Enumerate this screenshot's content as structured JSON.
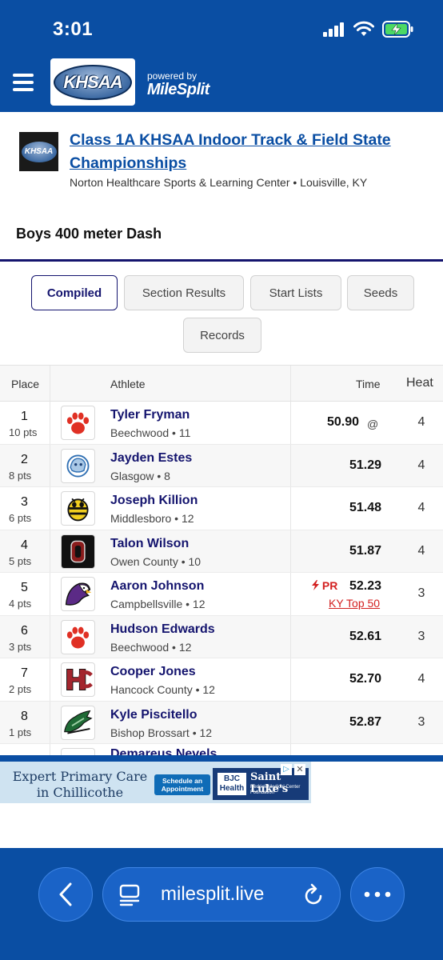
{
  "status_bar": {
    "time": "3:01"
  },
  "header": {
    "logo_text": "KHSAA",
    "powered_by": "powered by",
    "brand": "MileSplit"
  },
  "meet": {
    "logo_text": "KHSAA",
    "title": "Class 1A KHSAA Indoor Track & Field State Championships",
    "venue": "Norton Healthcare Sports & Learning Center • Louisville, KY"
  },
  "event": {
    "title": "Boys 400 meter Dash"
  },
  "tabs": [
    {
      "label": "Compiled",
      "active": true
    },
    {
      "label": "Section Results"
    },
    {
      "label": "Start Lists"
    },
    {
      "label": "Seeds"
    },
    {
      "label": "Records"
    }
  ],
  "table": {
    "headers": {
      "place": "Place",
      "athlete": "Athlete",
      "time": "Time",
      "heat": "Heat"
    },
    "rows": [
      {
        "place": "1",
        "pts": "10 pts",
        "name": "Tyler Fryman",
        "school": "Beechwood • 11",
        "time": "50.90",
        "mark": "@",
        "heat": "4",
        "logo": "paw-icon"
      },
      {
        "place": "2",
        "pts": "8 pts",
        "name": "Jayden Estes",
        "school": "Glasgow • 8",
        "time": "51.29",
        "heat": "4",
        "logo": "scotty-dog-icon"
      },
      {
        "place": "3",
        "pts": "6 pts",
        "name": "Joseph Killion",
        "school": "Middlesboro • 12",
        "time": "51.48",
        "heat": "4",
        "logo": "yellow-jacket-icon"
      },
      {
        "place": "4",
        "pts": "5 pts",
        "name": "Talon Wilson",
        "school": "Owen County • 10",
        "time": "51.87",
        "heat": "4",
        "logo": "letter-o-icon"
      },
      {
        "place": "5",
        "pts": "4 pts",
        "name": "Aaron Johnson",
        "school": "Campbellsville • 12",
        "time": "52.23",
        "pr": "PR",
        "rank_note": "KY Top 50",
        "heat": "3",
        "logo": "eagle-icon"
      },
      {
        "place": "6",
        "pts": "3 pts",
        "name": "Hudson Edwards",
        "school": "Beechwood • 12",
        "time": "52.61",
        "heat": "3",
        "logo": "paw-icon"
      },
      {
        "place": "7",
        "pts": "2 pts",
        "name": "Cooper Jones",
        "school": "Hancock County • 12",
        "time": "52.70",
        "heat": "4",
        "logo": "hc-monogram-icon"
      },
      {
        "place": "8",
        "pts": "1 pts",
        "name": "Kyle Piscitello",
        "school": "Bishop Brossart • 12",
        "time": "52.87",
        "heat": "3",
        "logo": "mustang-icon"
      }
    ],
    "partial_row": {
      "name": "Demareus Nevels"
    }
  },
  "ad": {
    "headline": "Expert Primary Care in Chillicothe",
    "cta": "Schedule an Appointment",
    "sponsor": "Saint Luke's",
    "sponsor_sub": "Hedrick Medical Center Foundation",
    "partner": "BJC Health"
  },
  "browser": {
    "url": "milesplit.live"
  },
  "colors": {
    "brand_blue": "#0a4ea3",
    "navy": "#14146e",
    "pr_red": "#d32020"
  }
}
